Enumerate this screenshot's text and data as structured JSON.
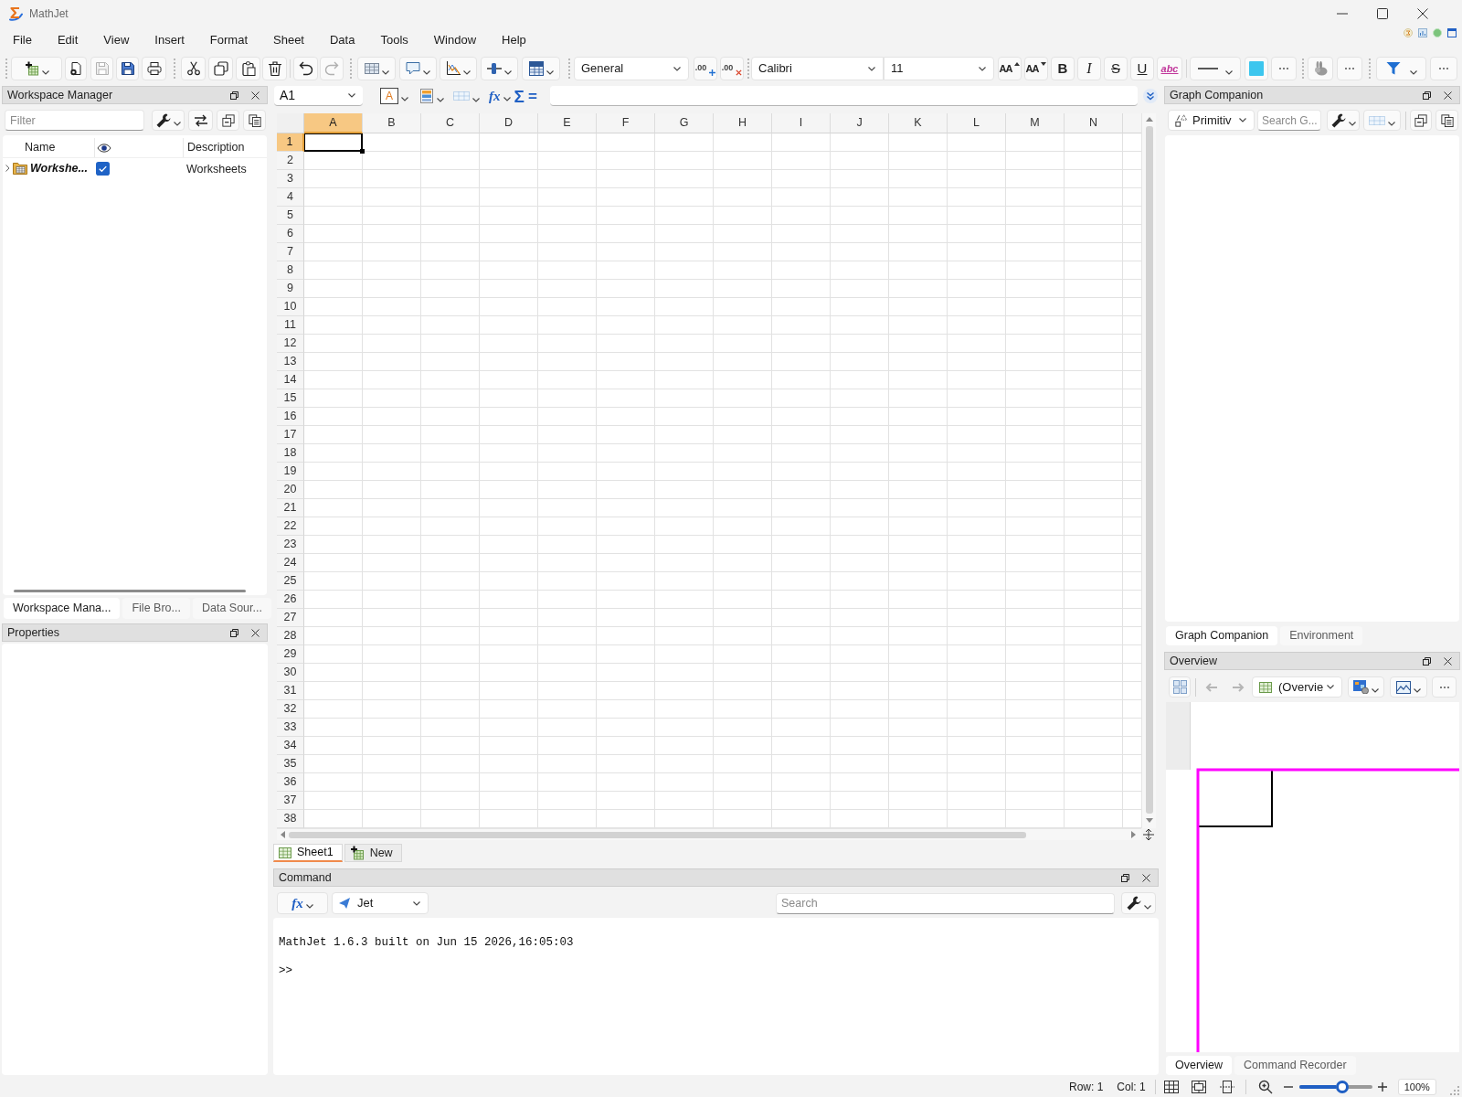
{
  "window": {
    "title": "MathJet"
  },
  "menu": [
    "File",
    "Edit",
    "View",
    "Insert",
    "Format",
    "Sheet",
    "Data",
    "Tools",
    "Window",
    "Help"
  ],
  "toolbar": {
    "save_disabled": true,
    "redo_disabled": true,
    "number_format": "General",
    "decimal_buttons": [
      {
        "kind": "increase",
        "label": ".00"
      },
      {
        "kind": "decrease",
        "label": ".00"
      }
    ],
    "font": "Calibri",
    "font_size": "11",
    "font_size_buttons": [
      {
        "kind": "grow",
        "label": "AA"
      },
      {
        "kind": "shrink",
        "label": "AA"
      }
    ],
    "style_buttons": [
      {
        "kind": "bold",
        "label": "B"
      },
      {
        "kind": "italic",
        "label": "I"
      },
      {
        "kind": "strikethrough",
        "label": "S"
      },
      {
        "kind": "underline",
        "label": "U"
      },
      {
        "kind": "spelling",
        "label": "abc"
      }
    ]
  },
  "workspace_manager": {
    "title": "Workspace Manager",
    "filter_placeholder": "Filter",
    "name_header": "Name",
    "description_header": "Description",
    "rows": [
      {
        "name": "Workshe...",
        "expanded": false,
        "checked": true,
        "description": "Worksheets"
      }
    ]
  },
  "left_tabs": [
    {
      "label": "Workspace Mana...",
      "selected": true
    },
    {
      "label": "File Bro...",
      "selected": false
    },
    {
      "label": "Data Sour...",
      "selected": false
    }
  ],
  "properties": {
    "title": "Properties"
  },
  "formula_bar": {
    "name_box": "A1",
    "text_color": "A",
    "function": "fx",
    "sum": "Σ",
    "equals": "="
  },
  "sheet": {
    "columns": [
      {
        "label": "A",
        "selected": true
      },
      {
        "label": "B",
        "selected": false
      },
      {
        "label": "C",
        "selected": false
      },
      {
        "label": "D",
        "selected": false
      },
      {
        "label": "E",
        "selected": false
      },
      {
        "label": "F",
        "selected": false
      },
      {
        "label": "G",
        "selected": false
      },
      {
        "label": "H",
        "selected": false
      },
      {
        "label": "I",
        "selected": false
      },
      {
        "label": "J",
        "selected": false
      },
      {
        "label": "K",
        "selected": false
      },
      {
        "label": "L",
        "selected": false
      },
      {
        "label": "M",
        "selected": false
      },
      {
        "label": "N",
        "selected": false
      }
    ],
    "rows": [
      {
        "label": "1",
        "selected": true
      },
      {
        "label": "2",
        "selected": false
      },
      {
        "label": "3",
        "selected": false
      },
      {
        "label": "4",
        "selected": false
      },
      {
        "label": "5",
        "selected": false
      },
      {
        "label": "6",
        "selected": false
      },
      {
        "label": "7",
        "selected": false
      },
      {
        "label": "8",
        "selected": false
      },
      {
        "label": "9",
        "selected": false
      },
      {
        "label": "10",
        "selected": false
      },
      {
        "label": "11",
        "selected": false
      },
      {
        "label": "12",
        "selected": false
      },
      {
        "label": "13",
        "selected": false
      },
      {
        "label": "14",
        "selected": false
      },
      {
        "label": "15",
        "selected": false
      },
      {
        "label": "16",
        "selected": false
      },
      {
        "label": "17",
        "selected": false
      },
      {
        "label": "18",
        "selected": false
      },
      {
        "label": "19",
        "selected": false
      },
      {
        "label": "20",
        "selected": false
      },
      {
        "label": "21",
        "selected": false
      },
      {
        "label": "22",
        "selected": false
      },
      {
        "label": "23",
        "selected": false
      },
      {
        "label": "24",
        "selected": false
      },
      {
        "label": "25",
        "selected": false
      },
      {
        "label": "26",
        "selected": false
      },
      {
        "label": "27",
        "selected": false
      },
      {
        "label": "28",
        "selected": false
      },
      {
        "label": "29",
        "selected": false
      },
      {
        "label": "30",
        "selected": false
      },
      {
        "label": "31",
        "selected": false
      },
      {
        "label": "32",
        "selected": false
      },
      {
        "label": "33",
        "selected": false
      },
      {
        "label": "34",
        "selected": false
      },
      {
        "label": "35",
        "selected": false
      },
      {
        "label": "36",
        "selected": false
      },
      {
        "label": "37",
        "selected": false
      },
      {
        "label": "38",
        "selected": false
      }
    ]
  },
  "sheet_tabs": [
    {
      "kind": "sheet",
      "label": "Sheet1",
      "selected": true
    },
    {
      "kind": "new",
      "label": "New",
      "selected": false
    }
  ],
  "command": {
    "title": "Command",
    "function": "fx",
    "language": "Jet",
    "search_placeholder": "Search",
    "output": [
      "MathJet 1.6.3 built on Jun 15 2026,16:05:03",
      ">>"
    ]
  },
  "graph_companion": {
    "title": "Graph Companion",
    "category": "Primitiv",
    "search_placeholder": "Search G..."
  },
  "right_tabs": [
    {
      "label": "Graph Companion",
      "selected": true
    },
    {
      "label": "Environment",
      "selected": false
    }
  ],
  "overview": {
    "title": "Overview",
    "back_disabled": true,
    "forward_disabled": true,
    "view": "(Overvie"
  },
  "overview_tabs": [
    {
      "label": "Overview",
      "selected": true
    },
    {
      "label": "Command Recorder",
      "selected": false
    }
  ],
  "status_bar": {
    "row": "Row: 1",
    "column": "Col: 1",
    "zoom": {
      "level": 0.5,
      "label": "100%"
    }
  }
}
